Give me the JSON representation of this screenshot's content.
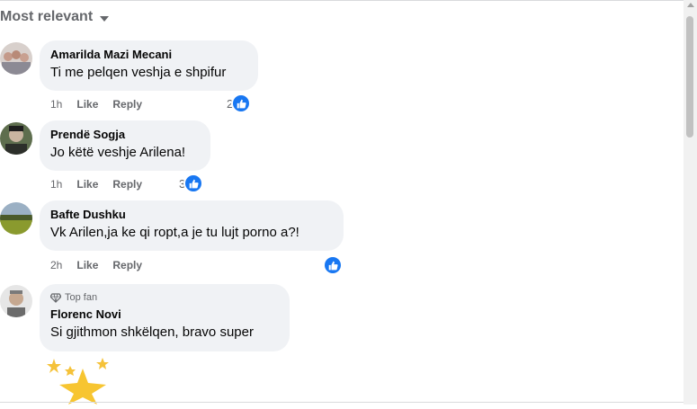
{
  "sort": {
    "label": "Most relevant"
  },
  "comments": [
    {
      "author": "Amarilda Mazi Mecani",
      "text": "Ti me pelqen veshja e shpifur",
      "time": "1h",
      "like": "Like",
      "reply": "Reply",
      "reactions": "2",
      "avatar_color": "#b8a8a0"
    },
    {
      "author": "Prendë Sogja",
      "text": "Jo këtë veshje Arilena!",
      "time": "1h",
      "like": "Like",
      "reply": "Reply",
      "reactions": "3",
      "avatar_color": "#3d4a3a"
    },
    {
      "author": "Bafte Dushku",
      "text": "Vk Arilen,ja ke qi ropt,a je tu lujt porno a?!",
      "time": "2h",
      "like": "Like",
      "reply": "Reply",
      "reactions": "",
      "avatar_color": "#6b7d3a"
    },
    {
      "badge": "Top fan",
      "author": "Florenc Novi",
      "text": "Si gjithmon shkëlqen, bravo super",
      "avatar_color": "#9a9a9a"
    }
  ],
  "colors": {
    "like_blue": "#1877f2",
    "bubble": "#f0f2f5",
    "muted": "#65676b"
  }
}
